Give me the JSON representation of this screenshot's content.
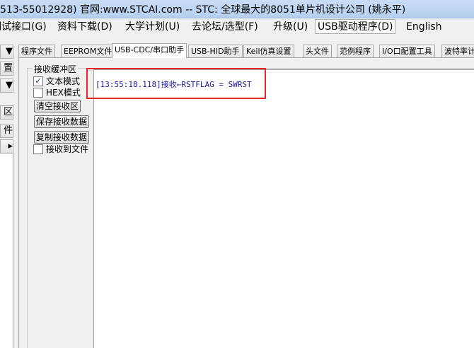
{
  "window": {
    "title": "513-55012928) 官网:www.STCAI.com  -- STC: 全球最大的8051单片机设计公司 (姚永平)"
  },
  "menu": [
    {
      "label": "调试接口(G)"
    },
    {
      "label": "资料下载(D)"
    },
    {
      "label": "大学计划(U)"
    },
    {
      "label": "去论坛/选型(F)"
    },
    {
      "label": "升级(U)"
    },
    {
      "label": "USB驱动程序(D)"
    },
    {
      "label": "English"
    }
  ],
  "left": {
    "buttons": [
      "▼",
      "置",
      "▼",
      "区",
      "件"
    ]
  },
  "tabs": [
    {
      "label": "程序文件"
    },
    {
      "label": "EEPROM文件"
    },
    {
      "label": "USB-CDC/串口助手"
    },
    {
      "label": "USB-HID助手"
    },
    {
      "label": "Keil仿真设置"
    },
    {
      "label": "头文件"
    },
    {
      "label": "范例程序"
    },
    {
      "label": "I/O口配置工具"
    },
    {
      "label": "波特率计"
    }
  ],
  "receive": {
    "group_label": "接收缓冲区",
    "text_mode_label": "文本模式",
    "text_mode_checked": "✓",
    "hex_mode_label": "HEX模式",
    "clear_button": "清空接收区",
    "save_button": "保存接收数据",
    "copy_button": "复制接收数据",
    "to_file_label": "接收到文件",
    "content": "[13:55:18.118]接收←RSTFLAG = SWRST"
  },
  "colors": {
    "highlight": "#e8262a",
    "recv_text": "#1a1aa0"
  }
}
